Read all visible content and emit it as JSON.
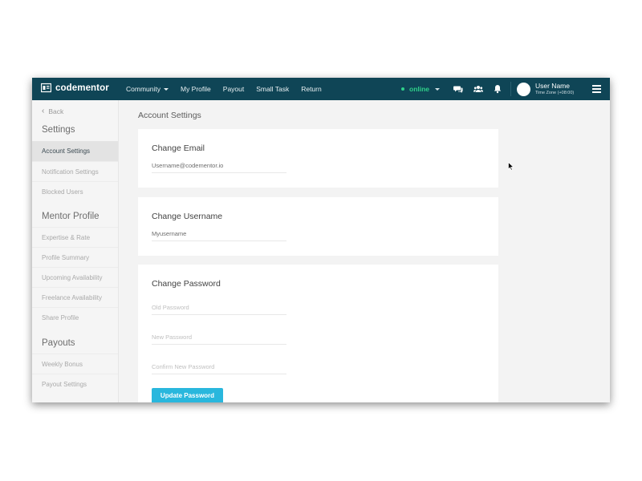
{
  "brand": {
    "name": "codementor"
  },
  "nav": {
    "items": [
      {
        "label": "Community",
        "dropdown": true
      },
      {
        "label": "My Profile",
        "dropdown": false
      },
      {
        "label": "Payout",
        "dropdown": false
      },
      {
        "label": "Small Task",
        "dropdown": false
      },
      {
        "label": "Return",
        "dropdown": false
      }
    ],
    "status": "online",
    "icons": [
      "chat-icon",
      "group-icon",
      "bell-icon",
      "hamburger-menu-icon"
    ]
  },
  "user": {
    "name": "User Name",
    "timezone": "Time Zone (+08:00)"
  },
  "sidebar": {
    "back": "Back",
    "sections": [
      {
        "heading": "Settings",
        "items": [
          "Account Settings",
          "Notification Settings",
          "Blocked Users"
        ]
      },
      {
        "heading": "Mentor Profile",
        "items": [
          "Expertise & Rate",
          "Profile Summary",
          "Upcoming Availability",
          "Freelance Availability",
          "Share Profile"
        ]
      },
      {
        "heading": "Payouts",
        "items": [
          "Weekly Bonus",
          "Payout Settings"
        ]
      }
    ],
    "active": "Account Settings"
  },
  "main": {
    "title": "Account Settings",
    "email": {
      "title": "Change Email",
      "value": "Username@codementor.io"
    },
    "username": {
      "title": "Change Username",
      "value": "Myusername"
    },
    "password": {
      "title": "Change Password",
      "old_placeholder": "Old Password",
      "new_placeholder": "New Password",
      "confirm_placeholder": "Confirm New Password",
      "button": "Update Password"
    }
  },
  "colors": {
    "topbar": "#0f4556",
    "online": "#2fd18a",
    "button": "#29b7dd",
    "page_bg": "#f3f3f3"
  }
}
